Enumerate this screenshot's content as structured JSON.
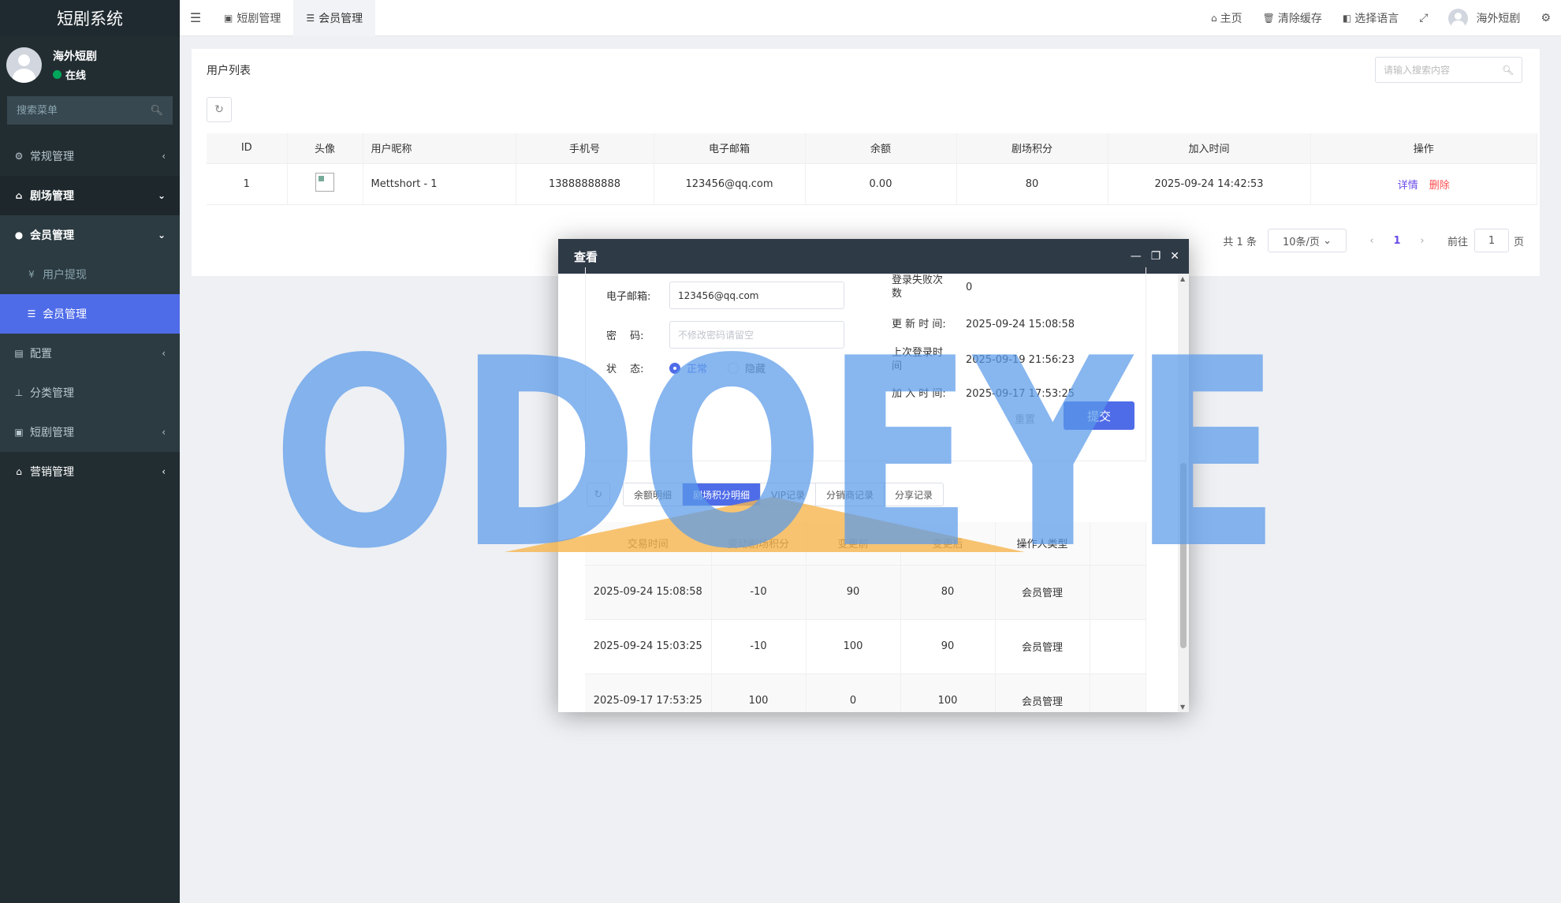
{
  "sidebar": {
    "logo": "短剧系统",
    "user_name": "海外短剧",
    "user_status": "在线",
    "search_placeholder": "搜索菜单",
    "items": [
      {
        "label": "常规管理",
        "icon": "cogs-icon"
      },
      {
        "label": "剧场管理",
        "icon": "home-icon"
      },
      {
        "label": "会员管理",
        "icon": "user-icon"
      },
      {
        "label": "用户提现",
        "icon": "yen-icon"
      },
      {
        "label": "会员管理",
        "icon": "list-icon"
      },
      {
        "label": "配置",
        "icon": "file-icon"
      },
      {
        "label": "分类管理",
        "icon": "sitemap-icon"
      },
      {
        "label": "短剧管理",
        "icon": "briefcase-icon"
      },
      {
        "label": "营销管理",
        "icon": "home-icon"
      }
    ]
  },
  "topbar": {
    "tabs": [
      {
        "label": "短剧管理",
        "icon": "briefcase-icon"
      },
      {
        "label": "会员管理",
        "icon": "list-icon"
      }
    ],
    "links": {
      "home": "主页",
      "clear_cache": "清除缓存",
      "language": "选择语言",
      "user": "海外短剧"
    }
  },
  "panel": {
    "title": "用户列表",
    "search_placeholder": "请输入搜索内容",
    "columns": [
      "ID",
      "头像",
      "用户昵称",
      "手机号",
      "电子邮箱",
      "余额",
      "剧场积分",
      "加入时间",
      "操作"
    ],
    "row": {
      "id": "1",
      "nickname": "Mettshort - 1",
      "phone": "13888888888",
      "email": "123456@qq.com",
      "balance": "0.00",
      "points": "80",
      "join_time": "2025-09-24 14:42:53",
      "detail": "详情",
      "delete": "删除"
    },
    "pager": {
      "total": "共 1 条",
      "page_size": "10条/页",
      "current": "1",
      "goto_prefix": "前往",
      "goto_value": "1",
      "goto_suffix": "页"
    }
  },
  "dialog": {
    "title": "查看",
    "form": {
      "email_label": "电子邮箱:",
      "email_value": "123456@qq.com",
      "password_label": "密　 码:",
      "password_placeholder": "不修改密码请留空",
      "status_label": "状　 态:",
      "status_normal": "正常",
      "status_hidden": "隐藏",
      "fail_label": "登录失败次数",
      "fail_value": "0",
      "update_label": "更 新 时 间:",
      "update_value": "2025-09-24 15:08:58",
      "last_login_label": "上次登录时间",
      "last_login_value": "2025-09-19 21:56:23",
      "join_label": "加 入 时 间:",
      "join_value": "2025-09-17 17:53:25",
      "reset": "重置",
      "submit": "提交"
    },
    "subtabs": [
      "余额明细",
      "剧场积分明细",
      "VIP记录",
      "分销商记录",
      "分享记录"
    ],
    "sub_columns": [
      "交易时间",
      "变动剧场积分",
      "变更前",
      "变更后",
      "操作人类型"
    ],
    "sub_rows": [
      [
        "2025-09-24 15:08:58",
        "-10",
        "90",
        "80",
        "会员管理"
      ],
      [
        "2025-09-24 15:03:25",
        "-10",
        "100",
        "90",
        "会员管理"
      ],
      [
        "2025-09-17 17:53:25",
        "100",
        "0",
        "100",
        "会员管理"
      ]
    ]
  },
  "watermark": {
    "text": "ODOEYE",
    "colors": {
      "blue": "#5b9bea",
      "orange": "#f6b54d"
    }
  },
  "colors": {
    "sidebar_bg": "#222d32",
    "accent": "#4f6ce8",
    "danger": "#ff4d4f"
  }
}
